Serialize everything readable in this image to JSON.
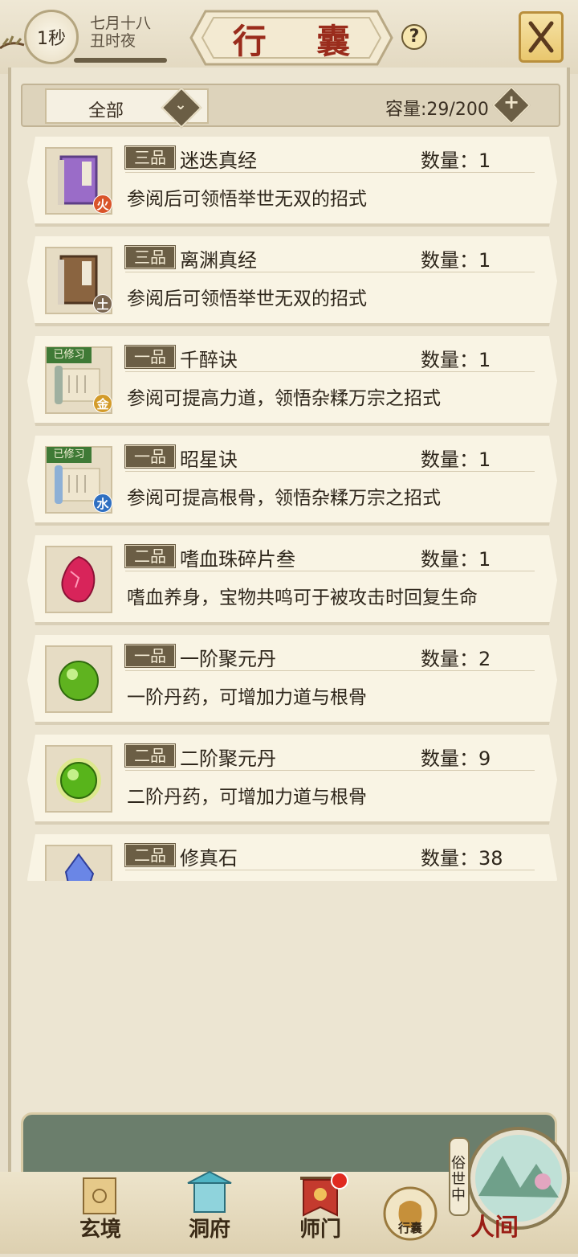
{
  "header": {
    "timer": "1秒",
    "date_line1": "七月十八",
    "date_line2": "丑时夜",
    "title": "行 囊",
    "help": "?"
  },
  "filter": {
    "selected": "全部",
    "capacity": "容量:29/200"
  },
  "items": [
    {
      "grade": "三品",
      "name": "迷迭真经",
      "qty": "数量：1",
      "desc": "参阅后可领悟举世无双的招式",
      "element": "火",
      "element_color": "#d9542a",
      "icon": "purple-book-icon"
    },
    {
      "grade": "三品",
      "name": "离渊真经",
      "qty": "数量：1",
      "desc": "参阅后可领悟举世无双的招式",
      "element": "土",
      "element_color": "#7a6650",
      "icon": "brown-book-icon"
    },
    {
      "grade": "一品",
      "name": "千醉诀",
      "qty": "数量：1",
      "desc": "参阅可提高力道，领悟杂糅万宗之招式",
      "element": "金",
      "element_color": "#d39b2a",
      "icon": "scroll-icon",
      "learned": "已修习"
    },
    {
      "grade": "一品",
      "name": "昭星诀",
      "qty": "数量：1",
      "desc": "参阅可提高根骨，领悟杂糅万宗之招式",
      "element": "水",
      "element_color": "#2f6fc1",
      "icon": "scroll-icon",
      "learned": "已修习"
    },
    {
      "grade": "二品",
      "name": "嗜血珠碎片叁",
      "qty": "数量：1",
      "desc": "嗜血养身，宝物共鸣可于被攻击时回复生命",
      "icon": "red-shard-icon"
    },
    {
      "grade": "一品",
      "name": "一阶聚元丹",
      "qty": "数量：2",
      "desc": "一阶丹药，可增加力道与根骨",
      "icon": "green-pill-icon"
    },
    {
      "grade": "二品",
      "name": "二阶聚元丹",
      "qty": "数量：9",
      "desc": "二阶丹药，可增加力道与根骨",
      "icon": "glowing-green-pill-icon"
    },
    {
      "grade": "二品",
      "name": "修真石",
      "qty": "数量：38",
      "desc": "",
      "icon": "blue-crystal-icon"
    }
  ],
  "nav": {
    "xuanjing": "玄境",
    "dongfu": "洞府",
    "shimen": "师门",
    "xingnang": "行囊",
    "renjian": "人间",
    "sushi": "俗世中"
  }
}
